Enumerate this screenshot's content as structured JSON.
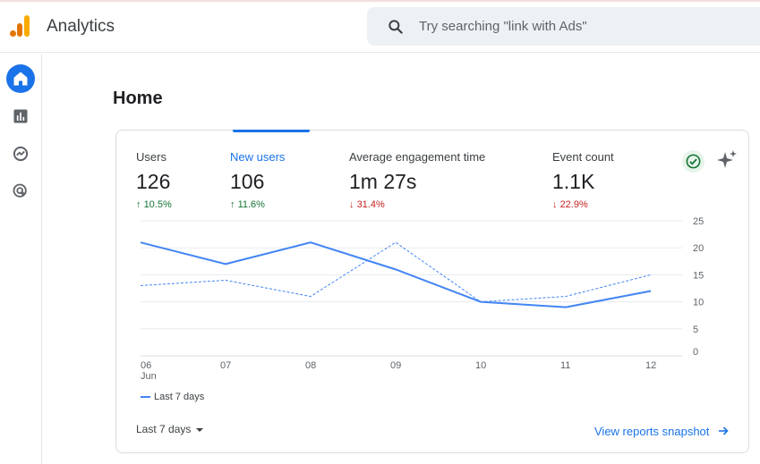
{
  "app": {
    "title": "Analytics"
  },
  "search": {
    "placeholder": "Try searching \"link with Ads\""
  },
  "sidebar": {
    "items": [
      {
        "name": "home-icon",
        "active": true
      },
      {
        "name": "reports-icon",
        "active": false
      },
      {
        "name": "explore-icon",
        "active": false
      },
      {
        "name": "advertising-icon",
        "active": false
      }
    ]
  },
  "page": {
    "title": "Home"
  },
  "metrics": [
    {
      "label": "Users",
      "value": "126",
      "delta": "10.5%",
      "direction": "up"
    },
    {
      "label": "New users",
      "value": "106",
      "delta": "11.6%",
      "direction": "up"
    },
    {
      "label": "Average engagement time",
      "value": "1m 27s",
      "delta": "31.4%",
      "direction": "down"
    },
    {
      "label": "Event count",
      "value": "1.1K",
      "delta": "22.9%",
      "direction": "down"
    }
  ],
  "colors": {
    "accent": "#1a73e8",
    "series": "#4285f4",
    "up": "#137333",
    "down": "#c5221f"
  },
  "chart_data": {
    "type": "line",
    "x": [
      "06",
      "07",
      "08",
      "09",
      "10",
      "11",
      "12"
    ],
    "x_sublabel": "Jun",
    "y_ticks": [
      0,
      5,
      10,
      15,
      20,
      25
    ],
    "ylim": [
      0,
      25
    ],
    "grid": true,
    "series": [
      {
        "name": "Last 7 days",
        "style": "solid",
        "values": [
          21,
          17,
          21,
          16,
          10,
          9,
          12
        ]
      },
      {
        "style": "dashed",
        "values": [
          13,
          14,
          11,
          21,
          10,
          11,
          15
        ]
      }
    ],
    "legend": "bottom-left"
  },
  "footer": {
    "range_label": "Last 7 days",
    "snapshot_link": "View reports snapshot"
  }
}
